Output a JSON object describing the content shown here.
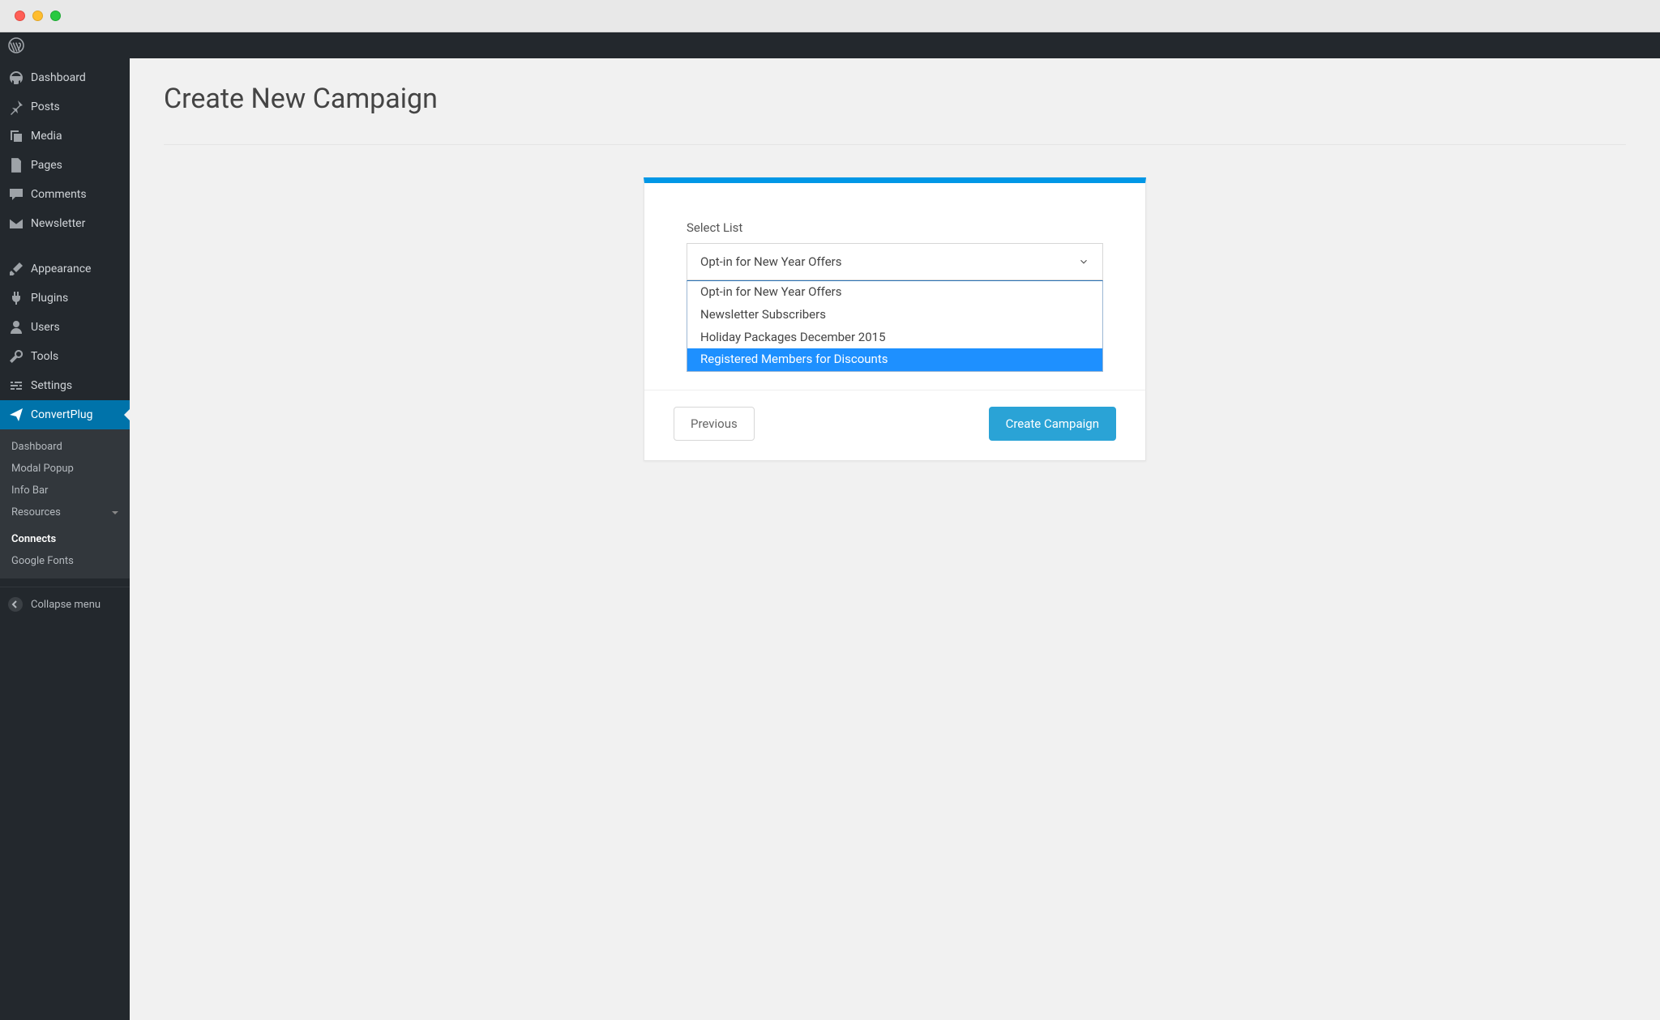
{
  "sidebar": {
    "items": [
      {
        "key": "dashboard",
        "label": "Dashboard",
        "icon": "dashboard"
      },
      {
        "key": "posts",
        "label": "Posts",
        "icon": "pin"
      },
      {
        "key": "media",
        "label": "Media",
        "icon": "media"
      },
      {
        "key": "pages",
        "label": "Pages",
        "icon": "pages"
      },
      {
        "key": "comments",
        "label": "Comments",
        "icon": "comment"
      },
      {
        "key": "newsletter",
        "label": "Newsletter",
        "icon": "mail"
      },
      {
        "key": "appearance",
        "label": "Appearance",
        "icon": "brush"
      },
      {
        "key": "plugins",
        "label": "Plugins",
        "icon": "plug"
      },
      {
        "key": "users",
        "label": "Users",
        "icon": "user"
      },
      {
        "key": "tools",
        "label": "Tools",
        "icon": "wrench"
      },
      {
        "key": "settings",
        "label": "Settings",
        "icon": "sliders"
      },
      {
        "key": "convertplug",
        "label": "ConvertPlug",
        "icon": "paperplane"
      }
    ],
    "active_key": "convertplug",
    "subitems": [
      {
        "key": "cp-dashboard",
        "label": "Dashboard"
      },
      {
        "key": "cp-modalpopup",
        "label": "Modal Popup"
      },
      {
        "key": "cp-infobar",
        "label": "Info Bar"
      },
      {
        "key": "cp-resources",
        "label": "Resources",
        "has_caret": true
      },
      {
        "key": "cp-connects",
        "label": "Connects",
        "strong": true
      },
      {
        "key": "cp-googlefonts",
        "label": "Google Fonts"
      }
    ],
    "collapse_label": "Collapse menu"
  },
  "page": {
    "title": "Create New Campaign"
  },
  "panel": {
    "field_label": "Select List",
    "selected": "Opt-in for New Year Offers",
    "options": [
      "Opt-in for New Year Offers",
      "Newsletter Subscribers",
      "Holiday Packages December 2015",
      "Registered Members for Discounts"
    ],
    "highlighted_index": 3,
    "previous_label": "Previous",
    "submit_label": "Create Campaign"
  }
}
